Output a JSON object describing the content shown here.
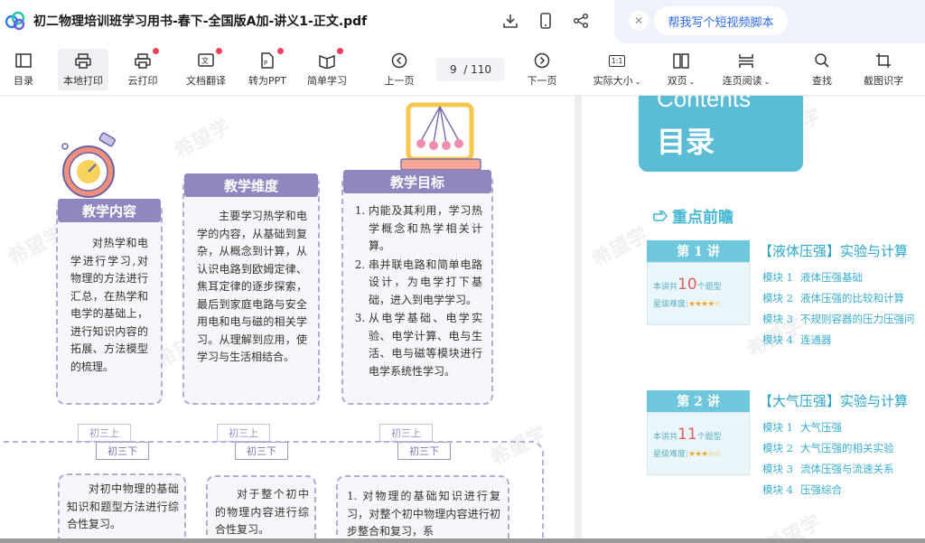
{
  "window": {
    "title": "初二物理培训班学习用书-春下-全国版A加-讲义1-正文.pdf",
    "ai_chip": "帮我写个短视频脚本",
    "close_symbol": "✕"
  },
  "toolbar": {
    "items": [
      {
        "label": "目录",
        "icon": "outline-icon",
        "dot": false
      },
      {
        "label": "本地打印",
        "icon": "printer-icon",
        "dot": false
      },
      {
        "label": "云打印",
        "icon": "cloud-printer-icon",
        "dot": true
      },
      {
        "label": "文档翻译",
        "icon": "translate-icon",
        "dot": true
      },
      {
        "label": "转为PPT",
        "icon": "ppt-icon",
        "dot": true
      },
      {
        "label": "简单学习",
        "icon": "study-icon",
        "dot": true
      },
      {
        "label": "上一页",
        "icon": "prev-page-icon",
        "dot": false
      },
      {
        "label": "下一页",
        "icon": "next-page-icon",
        "dot": false
      },
      {
        "label": "实际大小",
        "icon": "actual-size-icon",
        "dot": false
      },
      {
        "label": "双页",
        "icon": "double-page-icon",
        "dot": false
      },
      {
        "label": "连页阅读",
        "icon": "continuous-icon",
        "dot": false
      },
      {
        "label": "查找",
        "icon": "search-icon",
        "dot": false
      },
      {
        "label": "截图识字",
        "icon": "screenshot-ocr-icon",
        "dot": false
      }
    ],
    "page_current": "9",
    "page_total": "/ 110",
    "actual_size_glyph": "1:1",
    "caret": "⌄"
  },
  "left_page": {
    "watermarks": [
      "希望学",
      "希望学",
      "希望学",
      "希望学"
    ],
    "columns": [
      {
        "heading": "教学内容",
        "text": "对热学和电学进行学习,对物理的方法进行汇总，在热学和电学的基础上，进行知识内容的拓展、方法模型的梳理。"
      },
      {
        "heading": "教学维度",
        "text": "主要学习热学和电学的内容，从基础到复杂，从概念到计算，从认识电路到欧姆定律、焦耳定律的逐步探索，最后到家庭电路与安全用电和电与磁的相关学习。从理解到应用，使学习与生活相结合。"
      },
      {
        "heading": "教学目标",
        "items": [
          "内能及其利用，学习热学概念和热学相关计算。",
          "串并联电路和简单电路设计，为电学打下基础，进入到电学学习。",
          "从电学基础、电学实验、电学计算、电与生活、电与磁等模块进行电学系统性学习。"
        ]
      }
    ],
    "grades": {
      "upper": "初三上",
      "lower": "初三下"
    },
    "bottom_cards": [
      {
        "text": "对初中物理的基础知识和题型方法进行综合性复习。"
      },
      {
        "text": "对于整个初中的物理内容进行综合性复习。"
      },
      {
        "text": "1. 对物理的基础知识进行复习，对整个初中物理内容进行初步整合和复习，系"
      }
    ]
  },
  "right_page": {
    "contents_en": "Contents",
    "contents_cn": "目录",
    "focus_heading": "重点前瞻",
    "lectures": [
      {
        "tab": "第 1 讲",
        "title": "【液体压强】实验与计算",
        "note_prefix": "本讲共",
        "count": "10",
        "note_suffix": "个题型",
        "difficulty_label": "星级难度:",
        "stars": "★★★★☆",
        "modules": [
          {
            "code": "模块 1",
            "name": "液体压强基础"
          },
          {
            "code": "模块 2",
            "name": "液体压强的比较和计算"
          },
          {
            "code": "模块 3",
            "name": "不规则容器的压力压强问"
          },
          {
            "code": "模块 4",
            "name": "连通器"
          }
        ]
      },
      {
        "tab": "第 2 讲",
        "title": "【大气压强】实验与计算",
        "note_prefix": "本讲共",
        "count": "11",
        "note_suffix": "个题型",
        "difficulty_label": "星级难度:",
        "stars": "★★★☆☆",
        "modules": [
          {
            "code": "模块 1",
            "name": "大气压强"
          },
          {
            "code": "模块 2",
            "name": "大气压强的相关实验"
          },
          {
            "code": "模块 3",
            "name": "流体压强与流速关系"
          },
          {
            "code": "模块 4",
            "name": "压强综合"
          }
        ]
      }
    ]
  },
  "colors": {
    "accent": "#2e6ae6",
    "card_purple": "#8f87bf",
    "contents_blue": "#5bbcd6",
    "badge_red": "#f0405a"
  }
}
